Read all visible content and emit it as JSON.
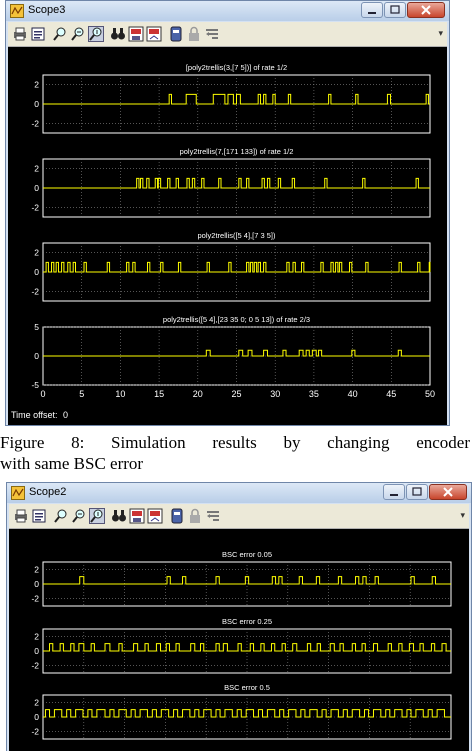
{
  "windows": [
    {
      "title": "Scope3",
      "toolbar_icons": [
        "print-icon",
        "params-icon",
        "zoom-icon",
        "zoom-x-icon",
        "zoom-y-icon",
        "binoculars-icon",
        "save-axes-icon",
        "restore-axes-icon",
        "floating-icon",
        "lock-icon",
        "signal-select-icon"
      ],
      "time_offset_label": "Time offset:",
      "time_offset_value": "0",
      "plots": [
        {
          "title": "[poly2trellis(3,[7 5])] of rate 1/2",
          "ylim": [
            -3,
            3
          ],
          "yticks": [
            "2",
            "0",
            "-2"
          ],
          "pulses": [
            [
              16.3,
              16.6
            ],
            [
              18.5,
              19.8
            ],
            [
              22,
              23.5
            ],
            [
              23.9,
              24.6
            ],
            [
              25,
              25.5
            ],
            [
              27.8,
              28.1
            ],
            [
              28.5,
              28.8
            ],
            [
              29.7,
              30
            ],
            [
              31.7,
              32
            ],
            [
              36.9,
              37.2
            ],
            [
              40.4,
              40.7
            ],
            [
              44.5,
              44.9
            ],
            [
              49.5,
              49.8
            ]
          ]
        },
        {
          "title": "poly2trellis(7,[171 133]) of rate 1/2",
          "ylim": [
            -3,
            3
          ],
          "yticks": [
            "2",
            "0",
            "-2"
          ],
          "pulses": [
            [
              12.1,
              12.4
            ],
            [
              12.6,
              12.9
            ],
            [
              13.4,
              13.7
            ],
            [
              14.5,
              14.8
            ],
            [
              14.9,
              15.2
            ],
            [
              16.1,
              16.4
            ],
            [
              17.2,
              17.5
            ],
            [
              18.6,
              18.9
            ],
            [
              19.3,
              19.6
            ],
            [
              20.5,
              20.8
            ],
            [
              22.7,
              23
            ],
            [
              25.3,
              25.6
            ],
            [
              26.3,
              26.6
            ],
            [
              28.3,
              28.6
            ],
            [
              29,
              29.3
            ],
            [
              30.4,
              30.7
            ],
            [
              32.2,
              32.5
            ],
            [
              36.4,
              36.7
            ],
            [
              41.3,
              41.6
            ],
            [
              48.2,
              48.5
            ]
          ]
        },
        {
          "title": "poly2trellis([5 4],[7 3 5])",
          "ylim": [
            -3,
            3
          ],
          "yticks": [
            "2",
            "0",
            "-2"
          ],
          "pulses": [
            [
              0.4,
              0.7
            ],
            [
              1.1,
              1.4
            ],
            [
              1.7,
              2
            ],
            [
              2.4,
              2.7
            ],
            [
              3.2,
              3.5
            ],
            [
              3.9,
              4.2
            ],
            [
              5.3,
              5.6
            ],
            [
              8.3,
              8.6
            ],
            [
              10.8,
              11.1
            ],
            [
              11.6,
              11.9
            ],
            [
              13.5,
              13.8
            ],
            [
              15.2,
              15.5
            ],
            [
              17.5,
              17.8
            ],
            [
              21.2,
              21.5
            ],
            [
              24,
              24.3
            ],
            [
              26.3,
              26.6
            ],
            [
              26.8,
              27.1
            ],
            [
              27.3,
              27.6
            ],
            [
              27.8,
              28.1
            ],
            [
              28.5,
              28.8
            ],
            [
              31.5,
              31.8
            ],
            [
              32.3,
              32.6
            ],
            [
              33.4,
              33.7
            ],
            [
              35.9,
              36.2
            ],
            [
              37.2,
              37.5
            ],
            [
              37.8,
              38.1
            ],
            [
              38.3,
              38.6
            ],
            [
              39.6,
              39.9
            ],
            [
              41.7,
              42
            ],
            [
              46,
              46.3
            ],
            [
              48.4,
              48.7
            ],
            [
              49.9,
              50
            ]
          ]
        },
        {
          "title": "poly2trellis([5 4],[23 35 0; 0 5 13]) of rate 2/3",
          "ylim": [
            -5,
            5
          ],
          "yticks": [
            "5",
            "0",
            "-5"
          ],
          "pulses": [
            [
              21.1,
              21.6
            ],
            [
              25.3,
              25.8
            ],
            [
              26.5,
              27
            ],
            [
              28.5,
              29
            ],
            [
              31,
              31.4
            ],
            [
              33.1,
              33.6
            ],
            [
              34,
              34.4
            ],
            [
              34.8,
              35.3
            ],
            [
              35.6,
              36
            ],
            [
              39.9,
              40.3
            ],
            [
              45.9,
              46.3
            ]
          ]
        }
      ],
      "xticks": [
        "0",
        "5",
        "10",
        "15",
        "20",
        "25",
        "30",
        "35",
        "40",
        "45",
        "50"
      ],
      "xlim": [
        0,
        50
      ]
    },
    {
      "title": "Scope2",
      "toolbar_icons": [
        "print-icon",
        "params-icon",
        "zoom-icon",
        "zoom-x-icon",
        "zoom-y-icon",
        "binoculars-icon",
        "save-axes-icon",
        "restore-axes-icon",
        "floating-icon",
        "lock-icon",
        "signal-select-icon"
      ],
      "plots": [
        {
          "title": "BSC error 0.05",
          "ylim": [
            -3,
            3
          ],
          "yticks": [
            "2",
            "0",
            "-2"
          ],
          "pulses": [
            [
              4.5,
              5
            ],
            [
              15.2,
              15.6
            ],
            [
              17.1,
              17.5
            ],
            [
              21.2,
              21.6
            ],
            [
              24.8,
              25.2
            ],
            [
              28.1,
              28.5
            ],
            [
              28.9,
              29.3
            ],
            [
              31.4,
              31.8
            ],
            [
              33.5,
              33.9
            ],
            [
              36.2,
              36.6
            ],
            [
              38.3,
              38.7
            ],
            [
              39.2,
              39.6
            ],
            [
              40.7,
              41.1
            ],
            [
              45.1,
              45.5
            ],
            [
              47.7,
              48.1
            ]
          ]
        },
        {
          "title": "BSC error 0.25",
          "ylim": [
            -3,
            3
          ],
          "yticks": [
            "2",
            "0",
            "-2"
          ],
          "pulses": [
            [
              0.8,
              1.2
            ],
            [
              2.1,
              2.5
            ],
            [
              3.4,
              3.8
            ],
            [
              4.4,
              5
            ],
            [
              5.9,
              6.3
            ],
            [
              7.6,
              8.2
            ],
            [
              9.3,
              9.7
            ],
            [
              11.1,
              11.6
            ],
            [
              12.5,
              12.9
            ],
            [
              13.9,
              14.4
            ],
            [
              15.1,
              15.5
            ],
            [
              16.3,
              16.7
            ],
            [
              18.1,
              18.6
            ],
            [
              19.3,
              19.7
            ],
            [
              21.2,
              21.6
            ],
            [
              22.1,
              22.6
            ],
            [
              23.9,
              24.3
            ],
            [
              25.4,
              25.8
            ],
            [
              26.7,
              27.1
            ],
            [
              28,
              28.4
            ],
            [
              29.3,
              29.7
            ],
            [
              30.6,
              31.1
            ],
            [
              32.4,
              32.8
            ],
            [
              33.6,
              34
            ],
            [
              35.2,
              35.7
            ],
            [
              36.4,
              36.8
            ],
            [
              37.9,
              38.3
            ],
            [
              39.1,
              39.5
            ],
            [
              40.5,
              41
            ],
            [
              42.3,
              42.7
            ],
            [
              43.6,
              44
            ],
            [
              44.9,
              45.4
            ],
            [
              46.2,
              46.6
            ],
            [
              47.6,
              48
            ],
            [
              48.9,
              49.4
            ]
          ]
        },
        {
          "title": "BSC error 0.5",
          "ylim": [
            -3,
            3
          ],
          "yticks": [
            "2",
            "0",
            "-2"
          ],
          "pulses": [
            [
              0.3,
              0.8
            ],
            [
              1.4,
              2.3
            ],
            [
              2.9,
              3.4
            ],
            [
              4,
              4.9
            ],
            [
              5.5,
              6
            ],
            [
              6.6,
              7.6
            ],
            [
              8.2,
              8.7
            ],
            [
              9.3,
              10.2
            ],
            [
              10.8,
              11.3
            ],
            [
              11.9,
              12.8
            ],
            [
              13.4,
              13.9
            ],
            [
              14.5,
              15.4
            ],
            [
              16,
              16.5
            ],
            [
              17.1,
              18
            ],
            [
              18.6,
              19.1
            ],
            [
              19.7,
              20.6
            ],
            [
              21.2,
              21.7
            ],
            [
              22.3,
              23.2
            ],
            [
              23.8,
              24.3
            ],
            [
              24.9,
              25.8
            ],
            [
              26.4,
              26.9
            ],
            [
              27.5,
              28.4
            ],
            [
              29,
              29.5
            ],
            [
              30.1,
              31
            ],
            [
              31.6,
              32.1
            ],
            [
              32.7,
              33.6
            ],
            [
              34.2,
              34.7
            ],
            [
              35.3,
              36.2
            ],
            [
              36.8,
              37.3
            ],
            [
              37.9,
              38.8
            ],
            [
              39.4,
              39.9
            ],
            [
              40.5,
              41.4
            ],
            [
              42,
              42.5
            ],
            [
              43.1,
              44
            ],
            [
              44.6,
              45.1
            ],
            [
              45.7,
              46.6
            ],
            [
              47.2,
              47.7
            ],
            [
              48.3,
              49.2
            ]
          ]
        }
      ],
      "xlim": [
        0,
        50
      ]
    }
  ],
  "caption": [
    "Figure 8: Simulation results by changing encoder",
    "with same BSC error"
  ]
}
